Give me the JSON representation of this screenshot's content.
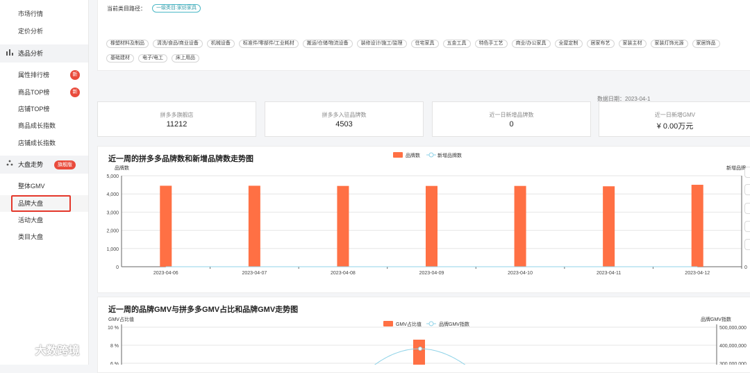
{
  "sidebar": {
    "items_top": [
      {
        "label": "市场行情"
      },
      {
        "label": "定价分析"
      }
    ],
    "group_selection": {
      "label": "选品分析",
      "icon": "bar-chart-icon"
    },
    "items_selection": [
      {
        "label": "属性排行榜",
        "badge": "新"
      },
      {
        "label": "商品TOP榜",
        "badge": "新"
      },
      {
        "label": "店铺TOP榜",
        "badge": ""
      },
      {
        "label": "商品成长指数",
        "badge": ""
      },
      {
        "label": "店铺成长指数",
        "badge": ""
      }
    ],
    "group_trend": {
      "label": "大盘走势",
      "icon": "dots-icon",
      "badge": "旗舰版"
    },
    "items_trend": [
      {
        "label": "整体GMV"
      },
      {
        "label": "品牌大盘",
        "active": true
      },
      {
        "label": "活动大盘"
      },
      {
        "label": "类目大盘"
      }
    ]
  },
  "category_path": {
    "label": "当前类目路径：",
    "tag": "一级类目:家纺家具"
  },
  "categories": [
    "橡塑材料及制品",
    "清洗/食品/商业设备",
    "机械设备",
    "标准件/零部件/工业耗材",
    "搬运/仓储/物流设备",
    "装修设计/施工/监理",
    "住宅家具",
    "五金工具",
    "特色手工艺",
    "商业/办公家具",
    "全屋定制",
    "居家布艺",
    "家装主材",
    "家装灯饰光源",
    "家居饰品",
    "基础建材",
    "电子/电工",
    "床上用品"
  ],
  "data_date": "数据日期：2023-04-1",
  "stat_cards": [
    {
      "label": "拼多多旗舰店",
      "value": "11212"
    },
    {
      "label": "拼多多入驻品牌数",
      "value": "4503"
    },
    {
      "label": "近一日新增品牌数",
      "value": "0"
    },
    {
      "label": "近一日新增GMV",
      "value": "¥ 0.00万元"
    }
  ],
  "chart1": {
    "title": "近一周的拼多多品牌数和新增品牌数走势图",
    "legend": [
      "品牌数",
      "新增品牌数"
    ],
    "y_left_name": "品牌数",
    "y_right_name": "新增品牌",
    "y_left_ticks": [
      "0",
      "1,000",
      "2,000",
      "3,000",
      "4,000",
      "5,000"
    ],
    "y_right_ticks": [
      "0"
    ]
  },
  "chart2": {
    "title": "近一周的品牌GMV与拼多多GMV占比和品牌GMV走势图",
    "legend": [
      "GMV占比值",
      "品牌GMV指数"
    ],
    "y_left_name": "GMV占比值",
    "y_right_name": "品牌GMV指数",
    "y_left_ticks": [
      "10 %",
      "8 %",
      "6 %"
    ],
    "y_right_ticks": [
      "500,000,000",
      "400,000,000",
      "300,000,000"
    ]
  },
  "chart_data": [
    {
      "type": "bar",
      "title": "近一周的拼多多品牌数和新增品牌数走势图",
      "categories": [
        "2023-04-06",
        "2023-04-07",
        "2023-04-08",
        "2023-04-09",
        "2023-04-10",
        "2023-04-11",
        "2023-04-12"
      ],
      "series": [
        {
          "name": "品牌数",
          "type": "bar",
          "values": [
            4450,
            4450,
            4440,
            4440,
            4440,
            4420,
            4503
          ]
        },
        {
          "name": "新增品牌数",
          "type": "line",
          "values": [
            0,
            0,
            0,
            0,
            0,
            0,
            0
          ]
        }
      ],
      "ylabel": "品牌数",
      "ylim": [
        0,
        5000
      ],
      "colors": {
        "bar": "#ff7044",
        "line": "#8fd3e8"
      }
    },
    {
      "type": "bar",
      "title": "近一周的品牌GMV与拼多多GMV占比和品牌GMV走势图",
      "ylabel": "GMV占比值",
      "ylim": [
        0,
        10
      ],
      "series": [
        {
          "name": "GMV占比值",
          "type": "bar"
        },
        {
          "name": "品牌GMV指数",
          "type": "line"
        }
      ],
      "colors": {
        "bar": "#ff7044",
        "line": "#8fd3e8"
      }
    }
  ],
  "watermark": "大数跨境"
}
